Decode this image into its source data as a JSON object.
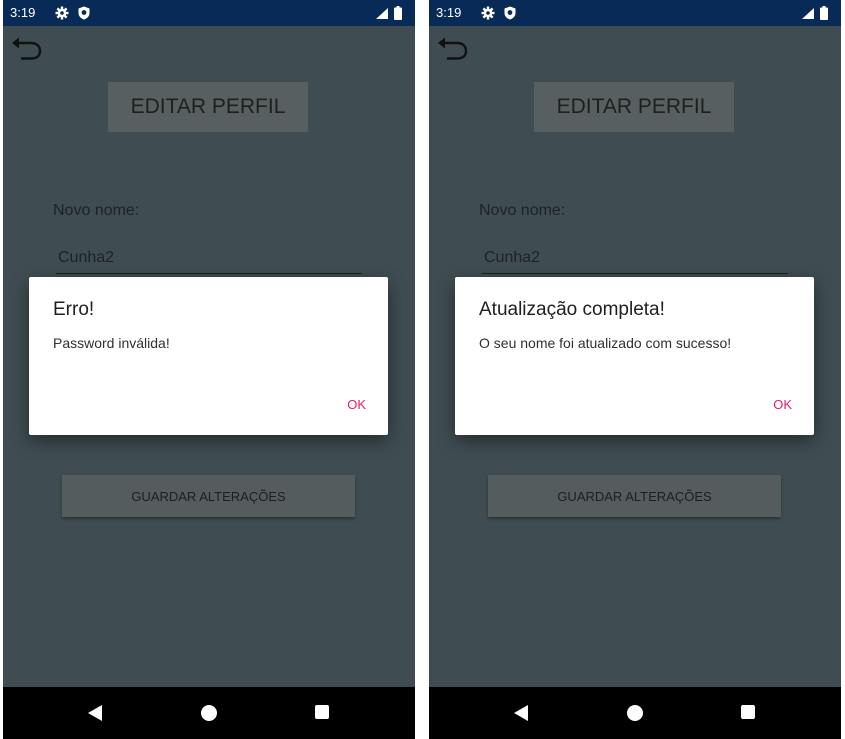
{
  "screens": [
    {
      "status": {
        "time": "3:19"
      },
      "page": {
        "title": "EDITAR PERFIL",
        "name_label": "Novo nome:",
        "name_value": "Cunha2",
        "save_label": "GUARDAR ALTERAÇÕES"
      },
      "dialog": {
        "title": "Erro!",
        "message": "Password inválida!",
        "ok_label": "OK"
      }
    },
    {
      "status": {
        "time": "3:19"
      },
      "page": {
        "title": "EDITAR PERFIL",
        "name_label": "Novo nome:",
        "name_value": "Cunha2",
        "save_label": "GUARDAR ALTERAÇÕES"
      },
      "dialog": {
        "title": "Atualização completa!",
        "message": "O seu nome foi atualizado com sucesso!",
        "ok_label": "OK"
      }
    }
  ],
  "icons": {
    "status": [
      "settings-gear-icon",
      "shield-icon",
      "signal-icon",
      "battery-icon"
    ],
    "toolbar": [
      "back-arrow-icon"
    ],
    "navigation": [
      "nav-back-icon",
      "nav-home-icon",
      "nav-recents-icon"
    ]
  },
  "colors": {
    "status_bar": "#082a57",
    "background_dimmed": "#3f4d52",
    "dialog_background": "#ffffff",
    "dialog_button": "#e91e63",
    "nav_bar": "#000000"
  }
}
